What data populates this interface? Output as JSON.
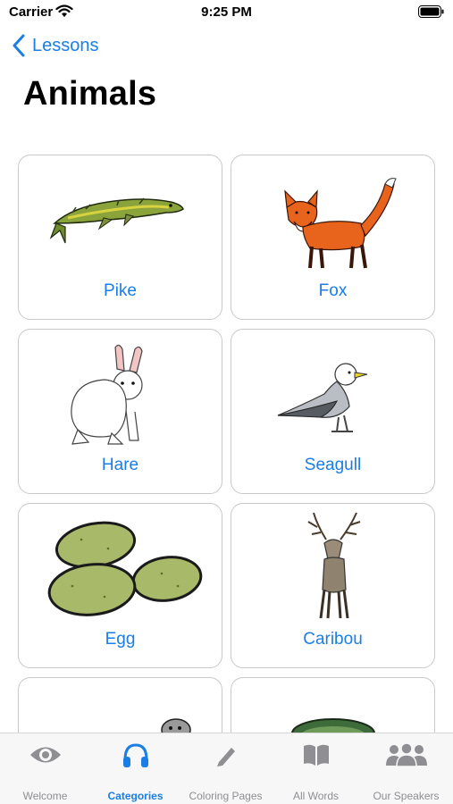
{
  "status_bar": {
    "carrier": "Carrier",
    "time": "9:25 PM"
  },
  "nav": {
    "back_label": "Lessons"
  },
  "page_title": "Animals",
  "cards": [
    {
      "label": "Pike",
      "icon": "pike-fish-icon"
    },
    {
      "label": "Fox",
      "icon": "fox-icon"
    },
    {
      "label": "Hare",
      "icon": "hare-icon"
    },
    {
      "label": "Seagull",
      "icon": "seagull-icon"
    },
    {
      "label": "Egg",
      "icon": "eggs-icon"
    },
    {
      "label": "Caribou",
      "icon": "caribou-icon"
    }
  ],
  "tabs": [
    {
      "label": "Welcome",
      "icon": "eye-icon",
      "active": false
    },
    {
      "label": "Categories",
      "icon": "headphones-icon",
      "active": true
    },
    {
      "label": "Coloring Pages",
      "icon": "pencil-icon",
      "active": false
    },
    {
      "label": "All Words",
      "icon": "book-icon",
      "active": false
    },
    {
      "label": "Our Speakers",
      "icon": "people-icon",
      "active": false
    }
  ],
  "colors": {
    "accent": "#1a7ee6",
    "inactive": "#8e8e93",
    "card_border": "#c9c9cb"
  }
}
